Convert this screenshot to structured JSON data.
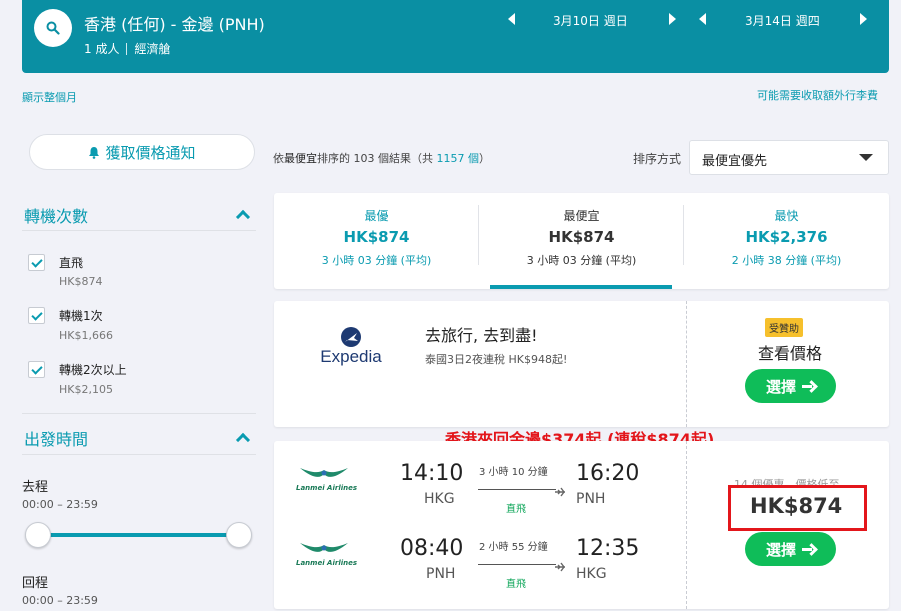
{
  "header": {
    "route": "香港 (任何) - 金邊 (PNH)",
    "passengers": "1 成人",
    "cabin": "經濟艙",
    "depart_date": "3月10日 週日",
    "return_date": "3月14日 週四"
  },
  "links": {
    "show_month": "顯示整個月",
    "extra_fees": "可能需要收取額外行李費"
  },
  "sidebar": {
    "price_alert": "獲取價格通知",
    "stops": {
      "title": "轉機次數",
      "options": [
        {
          "label": "直飛",
          "price": "HK$874",
          "checked": true
        },
        {
          "label": "轉機1次",
          "price": "HK$1,666",
          "checked": true
        },
        {
          "label": "轉機2次以上",
          "price": "HK$2,105",
          "checked": true
        }
      ]
    },
    "times": {
      "title": "出發時間",
      "outbound_label": "去程",
      "outbound_range": "00:00 – 23:59",
      "return_label": "回程",
      "return_range": "00:00 – 23:59"
    }
  },
  "results": {
    "count_prefix": "依",
    "count_sort": "最便宜",
    "count_middle": "排序的 103 個結果（共 ",
    "count_total": "1157 個",
    "count_suffix": "）",
    "sort_label": "排序方式",
    "sort_value": "最便宜優先"
  },
  "tabs": [
    {
      "title": "最優",
      "price": "HK$874",
      "duration": "3 小時 03 分鐘 (平均)"
    },
    {
      "title": "最便宜",
      "price": "HK$874",
      "duration": "3 小時 03 分鐘 (平均)"
    },
    {
      "title": "最快",
      "price": "HK$2,376",
      "duration": "2 小時 38 分鐘 (平均)"
    }
  ],
  "ad": {
    "logo": "Expedia",
    "title": "去旅行, 去到盡!",
    "desc": "泰國3日2夜連稅 HK$948起!",
    "badge": "受贊助",
    "view": "查看價格",
    "select": "選擇"
  },
  "promo": "香港來回金邊$374起 (連稅$874起)",
  "flight": {
    "airline_text": "Lanmei Airlines",
    "outbound": {
      "dep_time": "14:10",
      "dep_ap": "HKG",
      "duration": "3 小時 10 分鐘",
      "stops": "直飛",
      "arr_time": "16:20",
      "arr_ap": "PNH"
    },
    "inbound": {
      "dep_time": "08:40",
      "dep_ap": "PNH",
      "duration": "2 小時 55 分鐘",
      "stops": "直飛",
      "arr_time": "12:35",
      "arr_ap": "HKG"
    },
    "deals": "14 個優惠，價格低至",
    "price": "HK$874",
    "select": "選擇"
  },
  "colors": {
    "brand": "#0a8fa3",
    "link": "#0a9bb0",
    "select_button": "#0fbd59",
    "promo": "#e3161b",
    "badge": "#f6c02c"
  }
}
